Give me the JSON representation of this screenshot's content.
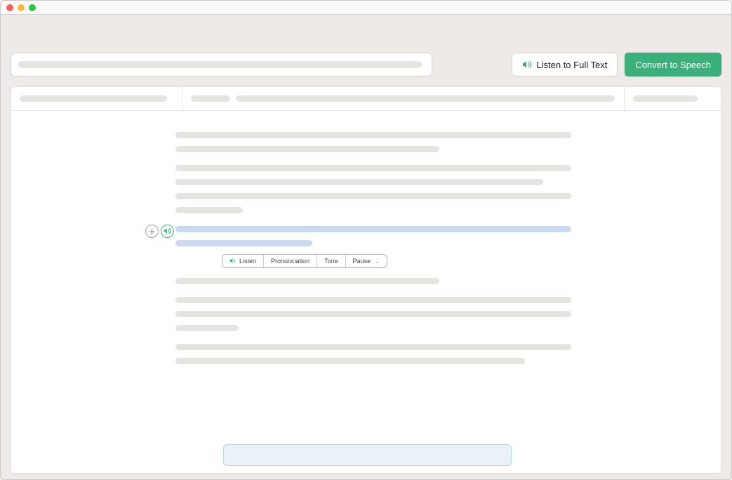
{
  "toolbar": {
    "listen_label": "Listen to Full Text",
    "convert_label": "Convert to Speech"
  },
  "tabs": {
    "bar1": "",
    "bar2a": "",
    "bar2b": "",
    "bar3": ""
  },
  "mini": {
    "listen": "Listen",
    "pronunciation": "Pronunciation",
    "tone": "Tone",
    "pause": "Pause"
  }
}
